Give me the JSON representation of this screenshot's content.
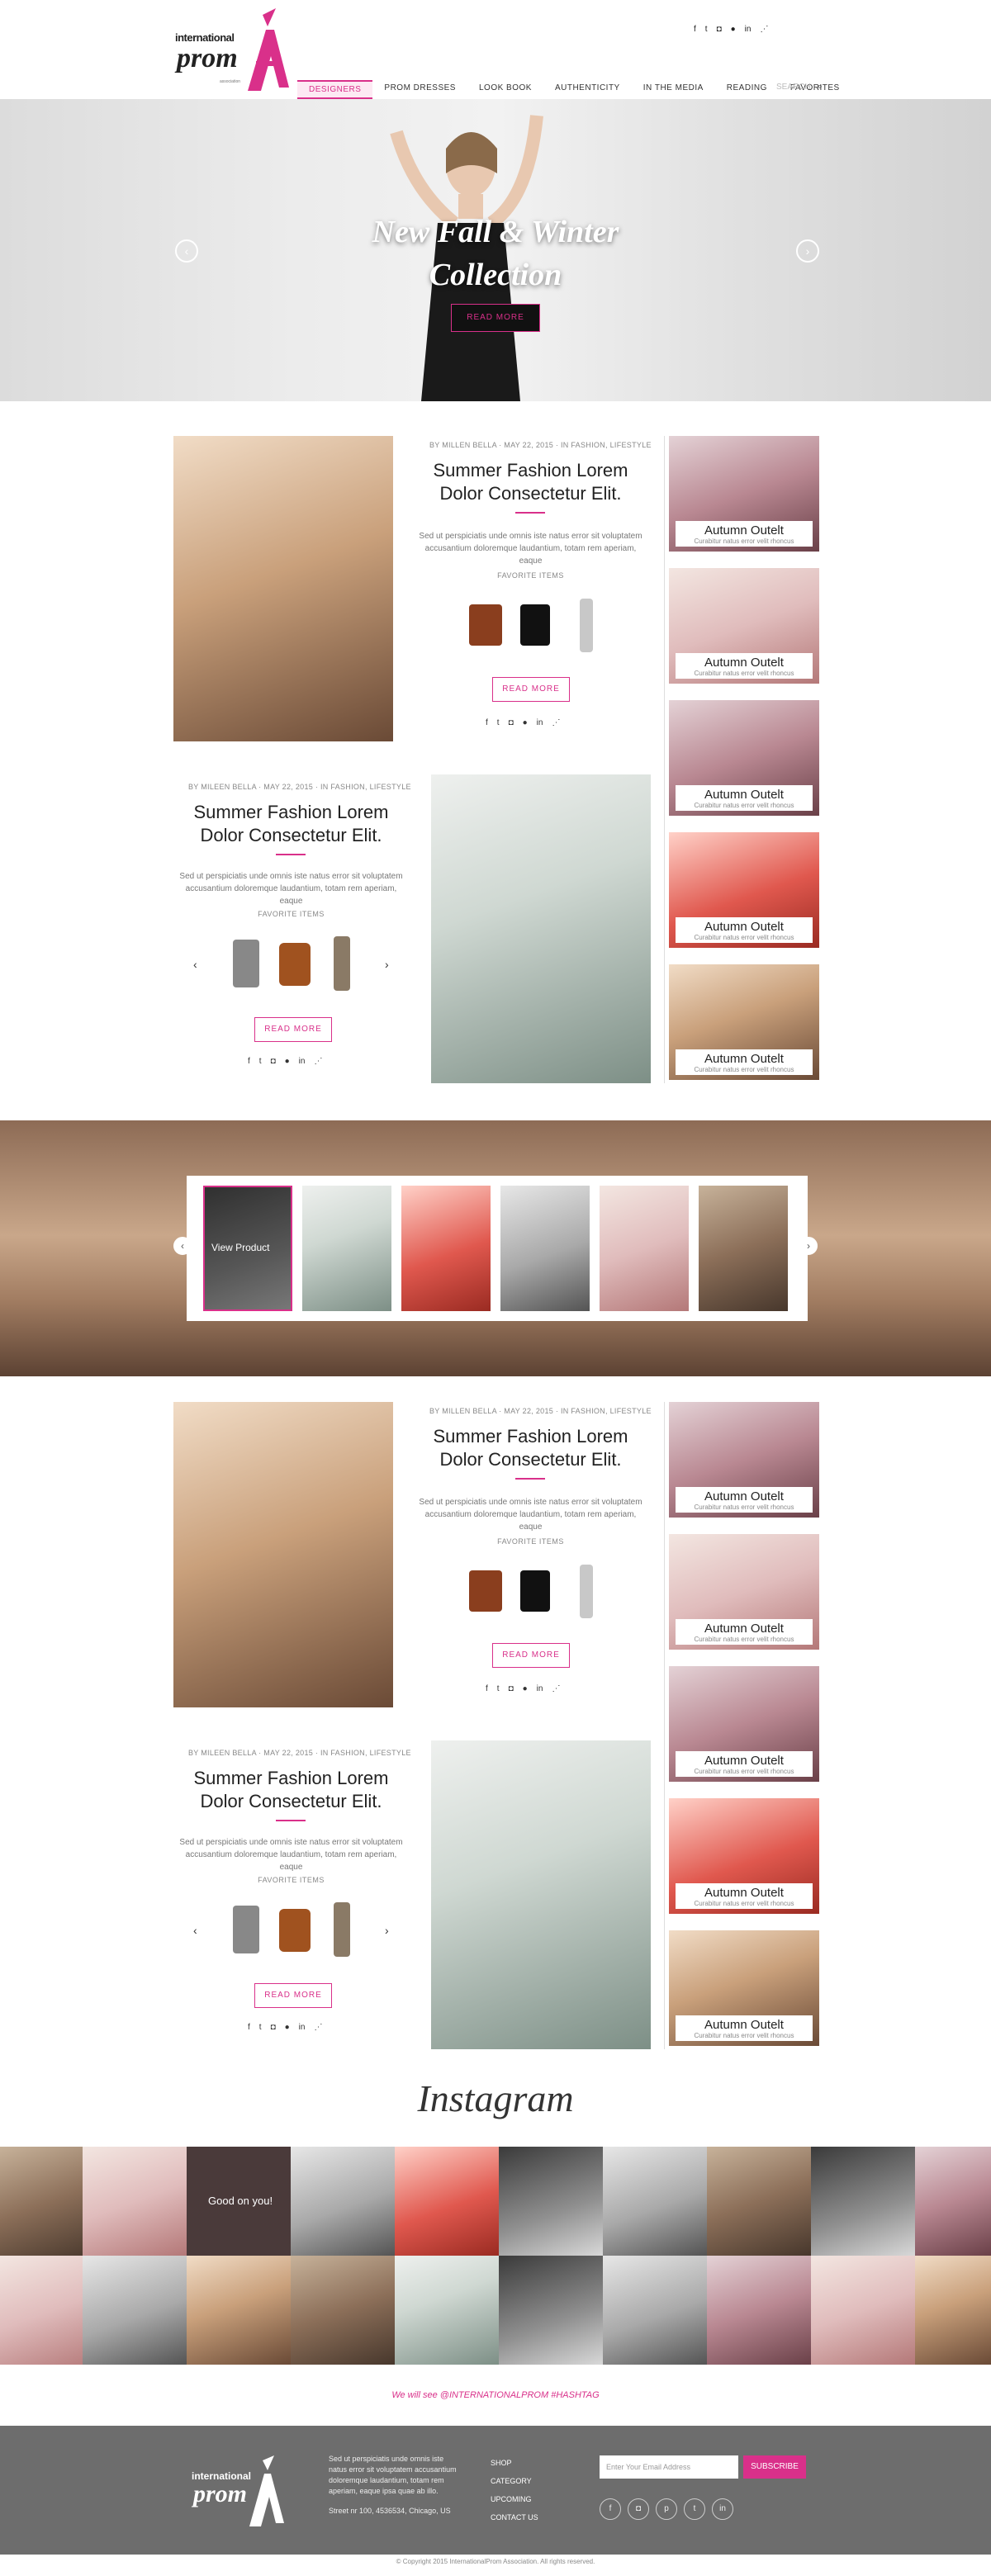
{
  "header": {
    "logo_text_1": "international",
    "logo_text_2": "prom",
    "logo_text_3": "association",
    "nav": [
      "DESIGNERS",
      "PROM DRESSES",
      "LOOK BOOK",
      "AUTHENTICITY",
      "IN THE MEDIA",
      "READING",
      "FAVORITES"
    ],
    "search_placeholder": "SEARCH"
  },
  "hero": {
    "title_line1": "New Fall & Winter",
    "title_line2": "Collection",
    "button": "READ MORE"
  },
  "post": {
    "meta_right": "BY MILLEN BELLA  ·  MAY 22, 2015  ·  IN FASHION, LIFESTYLE",
    "meta_left": "BY MILEEN BELLA  ·  MAY 22, 2015  ·  IN FASHION, LIFESTYLE",
    "title_line1": "Summer Fashion Lorem",
    "title_line2": "Dolor Consectetur Elit.",
    "text_line1": "Sed ut perspiciatis unde omnis iste natus error sit voluptatem",
    "text_line2": "accusantium doloremque laudantium, totam rem aperiam, eaque",
    "favs": "FAVORITE ITEMS",
    "readmore": "READ MORE"
  },
  "side_cards": [
    {
      "title": "Autumn Outelt",
      "sub": "Curabitur natus error velit rhoncus"
    },
    {
      "title": "Autumn Outelt",
      "sub": "Curabitur natus error velit rhoncus"
    },
    {
      "title": "Autumn Outelt",
      "sub": "Curabitur natus error velit rhoncus"
    },
    {
      "title": "Autumn Outelt",
      "sub": "Curabitur natus error velit rhoncus"
    },
    {
      "title": "Autumn Outelt",
      "sub": "Curabitur natus error velit rhoncus"
    }
  ],
  "slider": {
    "view_label": "View Product"
  },
  "instagram": {
    "title": "Instagram",
    "overlay": "Good on you!",
    "follow": "We will see @INTERNATIONALPROM #HASHTAG"
  },
  "footer": {
    "about_line1": "Sed ut perspiciatis unde omnis iste",
    "about_line2": "natus error sit voluptatem accusantium",
    "about_line3": "doloremque laudantium, totam rem",
    "about_line4": "aperiam, eaque ipsa quae ab illo.",
    "address": "Street nr 100, 4536534, Chicago, US",
    "links": [
      "SHOP",
      "CATEGORY",
      "UPCOMING",
      "CONTACT US"
    ],
    "email_placeholder": "Enter Your Email Address",
    "subscribe": "SUBSCRIBE",
    "copyright": "© Copyright 2015 InternationalProm Association. All rights reserved."
  },
  "colors": {
    "accent": "#d9308a",
    "footer_bg": "#6d6d6d"
  },
  "icons": [
    "facebook-icon",
    "twitter-icon",
    "instagram-icon",
    "pinterest-icon",
    "linkedin-icon",
    "rss-icon",
    "search-icon",
    "chevron-left-icon",
    "chevron-right-icon"
  ]
}
